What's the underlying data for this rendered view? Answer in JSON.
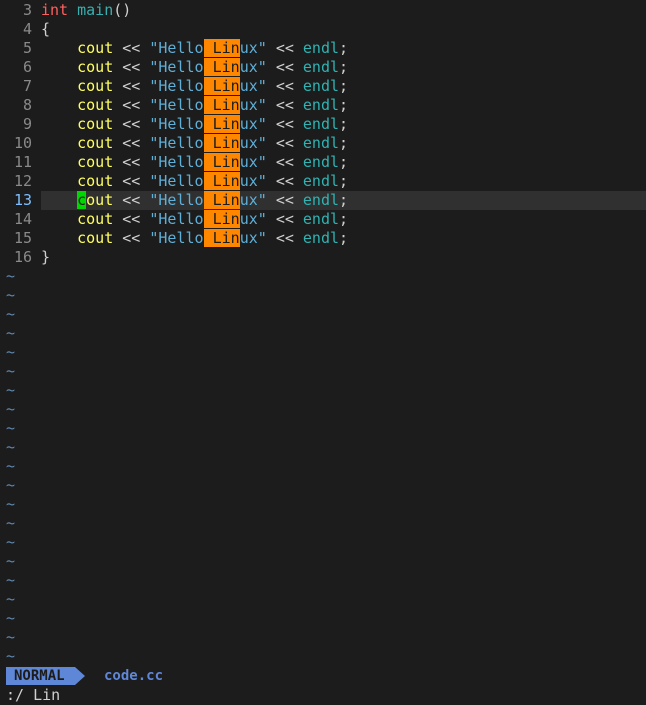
{
  "lines": [
    {
      "num": "3",
      "kw": "int",
      "fn": "main",
      "rest": "()"
    },
    {
      "num": "4",
      "text": "{"
    },
    {
      "num": "5"
    },
    {
      "num": "6"
    },
    {
      "num": "7"
    },
    {
      "num": "8"
    },
    {
      "num": "9"
    },
    {
      "num": "10"
    },
    {
      "num": "11"
    },
    {
      "num": "12"
    },
    {
      "num": "13"
    },
    {
      "num": "14"
    },
    {
      "num": "15"
    },
    {
      "num": "16",
      "text": "}"
    }
  ],
  "stmt": {
    "ident": "cout",
    "op": "<<",
    "str_open": "\"Hello",
    "str_space": " ",
    "str_match": "Lin",
    "str_tail": "ux\"",
    "endl": "endl",
    "semi": ";"
  },
  "cursor_line": "13",
  "tilde": "~",
  "status": {
    "mode": "NORMAL",
    "filename": "code.cc"
  },
  "command": ":/ Lin",
  "colors": {
    "background": "#1c1c1c",
    "search_highlight": "#ff8700",
    "cursor": "#00d700",
    "mode_bg": "#5f87d7"
  }
}
